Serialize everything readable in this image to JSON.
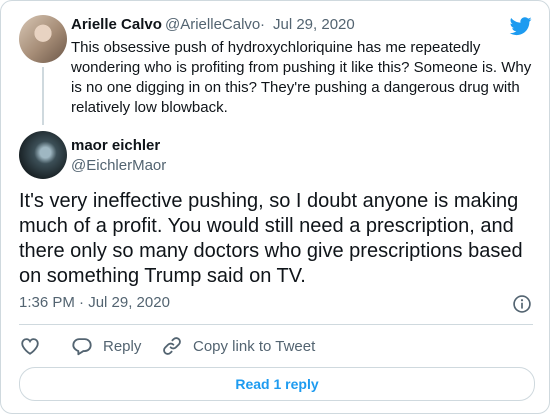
{
  "parent": {
    "name": "Arielle Calvo",
    "handle": "@ArielleCalvo",
    "separator": "·",
    "date": "Jul 29, 2020",
    "text": "This obsessive push of hydroxychloriquine has me repeatedly wondering who is profiting from pushing it like this? Someone is. Why is no one digging in on this? They're pushing a dangerous drug with relatively low blowback."
  },
  "tweet": {
    "name": "maor eichler",
    "handle": "@EichlerMaor",
    "text": "It's very ineffective pushing, so I doubt anyone is making much of a profit. You would still need a prescription, and there only so many doctors who give prescriptions based on something Trump said on TV.",
    "timestamp": "1:36 PM · Jul 29, 2020"
  },
  "actions": {
    "reply": "Reply",
    "copy_link": "Copy link to Tweet"
  },
  "read_replies": "Read 1 reply",
  "icons": {
    "logo": "twitter-bird-icon",
    "info": "info-icon",
    "like": "heart-icon",
    "reply": "reply-bubble-icon",
    "copy": "link-icon"
  },
  "colors": {
    "brand": "#1d9bf0",
    "text": "#0f1419",
    "muted": "#536471",
    "border": "#cfd9de"
  }
}
